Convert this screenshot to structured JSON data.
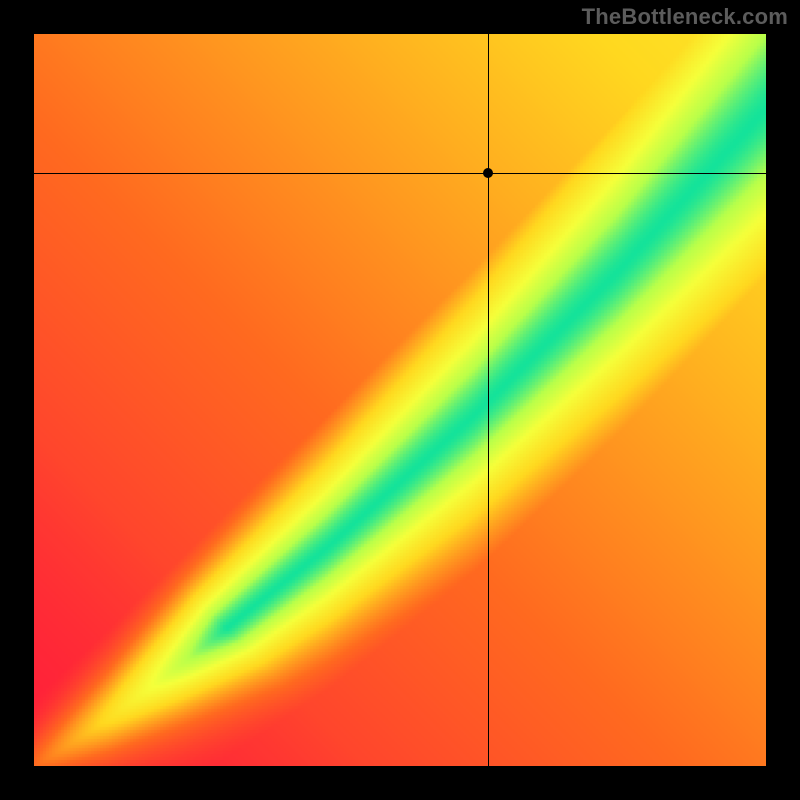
{
  "watermark": "TheBottleneck.com",
  "chart_data": {
    "type": "heatmap",
    "title": "",
    "xlabel": "",
    "ylabel": "",
    "xlim": [
      0,
      100
    ],
    "ylim": [
      0,
      100
    ],
    "crosshair": {
      "x": 62,
      "y": 81
    },
    "colormap_stops": [
      {
        "t": 0.0,
        "color": "#ff1f3a"
      },
      {
        "t": 0.25,
        "color": "#ff6a1f"
      },
      {
        "t": 0.5,
        "color": "#ffd81f"
      },
      {
        "t": 0.7,
        "color": "#f5ff3a"
      },
      {
        "t": 0.85,
        "color": "#b8ff4a"
      },
      {
        "t": 1.0,
        "color": "#14e39a"
      }
    ],
    "optimal_band": {
      "description": "green diagonal optimal region; width grows with x; center curves from origin toward upper-right",
      "center_points": [
        {
          "x": 0,
          "y": 0
        },
        {
          "x": 10,
          "y": 6.5
        },
        {
          "x": 20,
          "y": 14
        },
        {
          "x": 30,
          "y": 22
        },
        {
          "x": 40,
          "y": 30
        },
        {
          "x": 50,
          "y": 39
        },
        {
          "x": 60,
          "y": 48
        },
        {
          "x": 70,
          "y": 58
        },
        {
          "x": 80,
          "y": 68
        },
        {
          "x": 90,
          "y": 79
        },
        {
          "x": 100,
          "y": 90
        }
      ],
      "half_width_at_x": [
        {
          "x": 0,
          "w": 0.5
        },
        {
          "x": 20,
          "w": 2.5
        },
        {
          "x": 40,
          "w": 4.5
        },
        {
          "x": 60,
          "w": 6.5
        },
        {
          "x": 80,
          "w": 8.5
        },
        {
          "x": 100,
          "w": 11
        }
      ]
    },
    "grid": false,
    "legend": null
  },
  "marker": {
    "shape": "circle",
    "color": "#000000"
  }
}
